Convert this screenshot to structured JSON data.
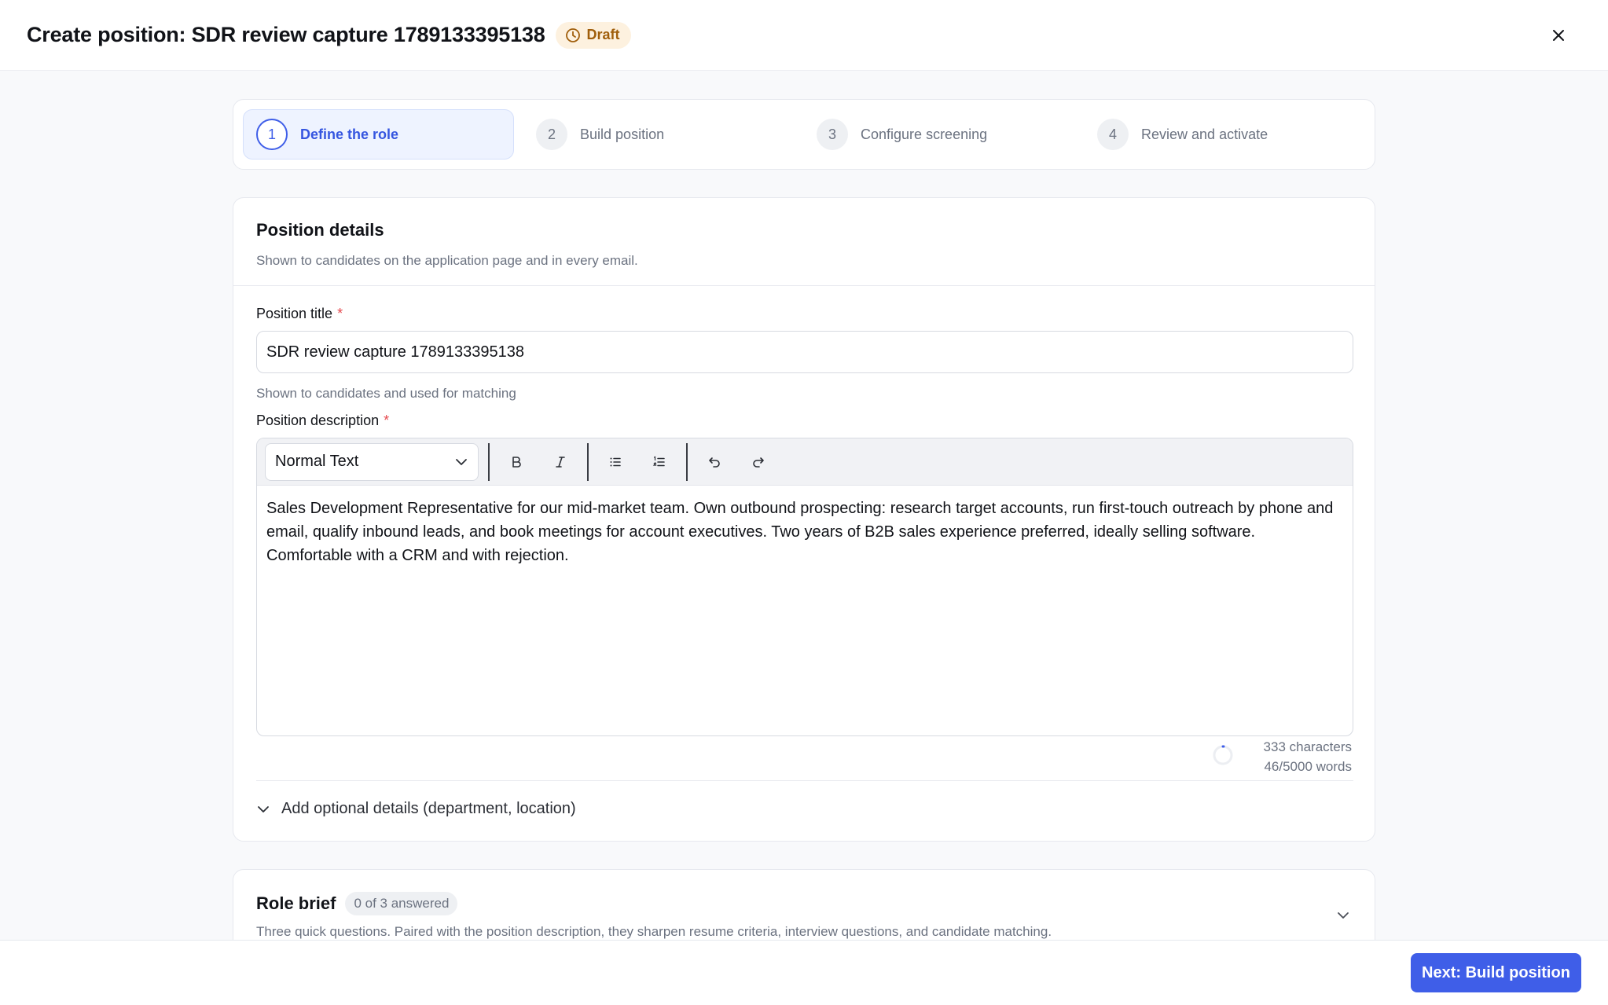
{
  "header": {
    "title": "Create position: SDR review capture 1789133395138",
    "status_badge": "Draft",
    "close_icon": "close-icon"
  },
  "stepper": {
    "steps": [
      {
        "number": "1",
        "label": "Define the role",
        "active": true
      },
      {
        "number": "2",
        "label": "Build position",
        "active": false
      },
      {
        "number": "3",
        "label": "Configure screening",
        "active": false
      },
      {
        "number": "4",
        "label": "Review and activate",
        "active": false
      }
    ]
  },
  "position_details": {
    "title": "Position details",
    "subtitle": "Shown to candidates on the application page and in every email.",
    "position_title": {
      "label": "Position title",
      "required_mark": "*",
      "value": "SDR review capture 1789133395138",
      "hint": "Shown to candidates and used for matching"
    },
    "position_description": {
      "label": "Position description",
      "required_mark": "*",
      "text_style": "Normal Text",
      "body": "Sales Development Representative for our mid-market team. Own outbound prospecting: research target accounts, run first-touch outreach by phone and email, qualify inbound leads, and book meetings for account executives. Two years of B2B sales experience preferred, ideally selling software. Comfortable with a CRM and with rejection.",
      "character_count": "333 characters",
      "word_count": "46/5000 words",
      "word_fraction": 0.0092
    },
    "optional_details_label": "Add optional details (department, location)"
  },
  "role_brief": {
    "title": "Role brief",
    "progress_pill": "0 of 3 answered",
    "subtitle": "Three quick questions. Paired with the position description, they sharpen resume criteria, interview questions, and candidate matching."
  },
  "footer": {
    "next_button": "Next: Build position"
  },
  "colors": {
    "accent": "#3f5ee8",
    "draft_badge_bg": "#fdf1df",
    "draft_badge_text": "#a05e0b",
    "required": "#e5484d"
  }
}
